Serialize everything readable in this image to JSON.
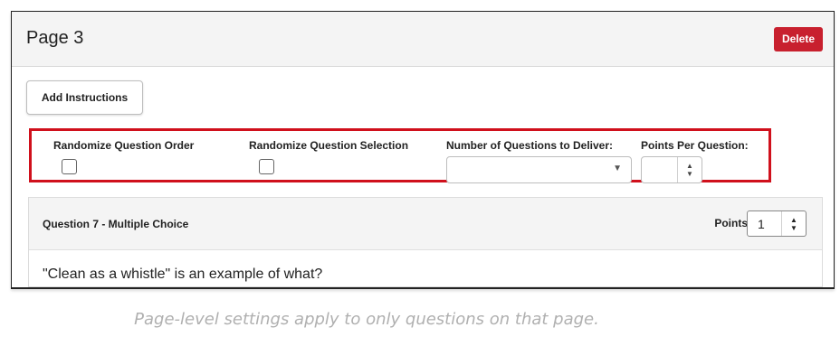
{
  "page": {
    "title": "Page 3",
    "delete_label": "Delete"
  },
  "toolbar": {
    "add_instructions_label": "Add Instructions"
  },
  "settings": {
    "randomize_order_label": "Randomize Question Order",
    "randomize_order_checked": false,
    "randomize_selection_label": "Randomize Question Selection",
    "randomize_selection_checked": false,
    "num_questions_label": "Number of Questions to Deliver:",
    "num_questions_value": "",
    "points_per_question_label": "Points Per Question:",
    "points_per_question_value": ""
  },
  "question": {
    "title": "Question 7 - Multiple Choice",
    "points_label": "Points",
    "points_value": "1",
    "text": "\"Clean as a whistle\" is an example of what?"
  },
  "caption": "Page-level settings apply to only questions on that page.",
  "colors": {
    "delete_button": "#c8202e",
    "highlight_border": "#d0101c",
    "header_background": "#f4f4f4"
  },
  "icons": {
    "select_arrow": "chevron-down-icon",
    "stepper": "up-down-arrows-icon"
  }
}
